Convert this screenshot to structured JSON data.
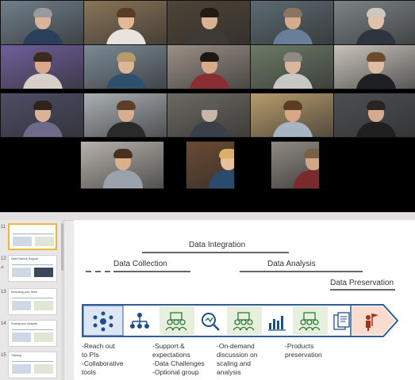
{
  "video": {
    "tiles": [
      {
        "bg": "#6f7f8a",
        "skin": "#d8b59a",
        "hair": "#9a9a9a",
        "shirt": "#2b3f5c"
      },
      {
        "bg": "#8a7458",
        "skin": "#e2b895",
        "hair": "#5a3b26",
        "shirt": "#e8e3dc"
      },
      {
        "bg": "#4e4436",
        "skin": "#d9b293",
        "hair": "#241a14",
        "shirt": "#3e3a36"
      },
      {
        "bg": "#5c6a72",
        "skin": "#d6ab8c",
        "hair": "#8b7560",
        "shirt": "#6b7e99"
      },
      {
        "bg": "#7c8487",
        "skin": "#e1c1a8",
        "hair": "#cfc7be",
        "shirt": "#2e3440"
      },
      {
        "bg": "#6f5f9a",
        "skin": "#d9a98a",
        "hair": "#3a2a1f",
        "shirt": "#d7d0c8"
      },
      {
        "bg": "#7b8a95",
        "skin": "#dcb595",
        "hair": "#b79a6a",
        "shirt": "#2f4f6c"
      },
      {
        "bg": "#9a9086",
        "skin": "#d6ac8a",
        "hair": "#1e1814",
        "shirt": "#8a2e34"
      },
      {
        "bg": "#6c7a66",
        "skin": "#dab79c",
        "hair": "#8d8a86",
        "shirt": "#c9c7c4"
      },
      {
        "bg": "#c8c2bb",
        "skin": "#e0bca0",
        "hair": "#6b4a2e",
        "shirt": "#1d1f22"
      },
      {
        "bg": "#4e4d66",
        "skin": "#d8b299",
        "hair": "#2d241c",
        "shirt": "#6d6a8a"
      },
      {
        "bg": "#aab0b4",
        "skin": "#d7ad8e",
        "hair": "#5b3f2a",
        "shirt": "#2a2a2a"
      },
      {
        "bg": "#6b6a62",
        "skin": "#c9b6a8",
        "hair": "#5d5b58",
        "shirt": "#3a4048"
      },
      {
        "bg": "#b69c6c",
        "skin": "#d6a687",
        "hair": "#5a3d22",
        "shirt": "#a7b4c2"
      },
      {
        "bg": "#4c4f52",
        "skin": "#d4ab8e",
        "hair": "#2a2420",
        "shirt": "#1f1f1f"
      },
      {
        "bg": "#b6b1aa",
        "skin": "#dcb08d",
        "hair": "#4a3020",
        "shirt": "#9aa3ab"
      },
      {
        "bg": "#6a4a32",
        "skin": "#e6c19c",
        "hair": "#d8b069",
        "shirt": "#2a4b6e"
      },
      {
        "bg": "#8f8a82",
        "skin": "#d1a688",
        "hair": "#7a6046",
        "shirt": "#7a2a2a"
      }
    ]
  },
  "thumbs": [
    {
      "num": "11",
      "icon": "",
      "title": "",
      "active": true
    },
    {
      "num": "12",
      "icon": "⌀",
      "title": "Data Science Support",
      "active": false
    },
    {
      "num": "13",
      "icon": "",
      "title": "Recruiting your Team",
      "active": false
    },
    {
      "num": "14",
      "icon": "",
      "title": "Scaling your Analysis",
      "active": false
    },
    {
      "num": "15",
      "icon": "",
      "title": "Training",
      "active": false
    }
  ],
  "slide": {
    "stages": {
      "integration": "Data Integration",
      "collection": "Data Collection",
      "analysis": "Data Analysis",
      "preservation": "Data Preservation"
    },
    "steps": [
      {
        "icon": "network-icon",
        "color": "#1f4e8c",
        "bg": "#dde7f3"
      },
      {
        "icon": "org-chart-icon",
        "color": "#1f4e8c",
        "bg": "#ffffff"
      },
      {
        "icon": "team-icon",
        "color": "#2f7a3a",
        "bg": "#e6f0dc"
      },
      {
        "icon": "magnify-icon",
        "color": "#1f4e8c",
        "bg": "#ffffff"
      },
      {
        "icon": "team-icon",
        "color": "#2f7a3a",
        "bg": "#e6f0dc"
      },
      {
        "icon": "bar-chart-icon",
        "color": "#1f4e8c",
        "bg": "#ffffff"
      },
      {
        "icon": "team-icon",
        "color": "#2f7a3a",
        "bg": "#e6f0dc"
      },
      {
        "icon": "documents-icon",
        "color": "#1f4e8c",
        "bg": "#ffffff"
      },
      {
        "icon": "flag-person-icon",
        "color": "#a1301f",
        "bg": "#f9dccd"
      }
    ],
    "bullets": {
      "col1": [
        "-Reach out",
        " to PIs",
        "-Collaborative",
        " tools"
      ],
      "col2": [
        "-Support &",
        " expectations",
        "-Data Challenges",
        "-Optional group"
      ],
      "col3": [
        "-On-demand",
        " discussion on",
        " scaling and",
        " analysis"
      ],
      "col4": [
        "-Products",
        " preservation"
      ]
    }
  }
}
